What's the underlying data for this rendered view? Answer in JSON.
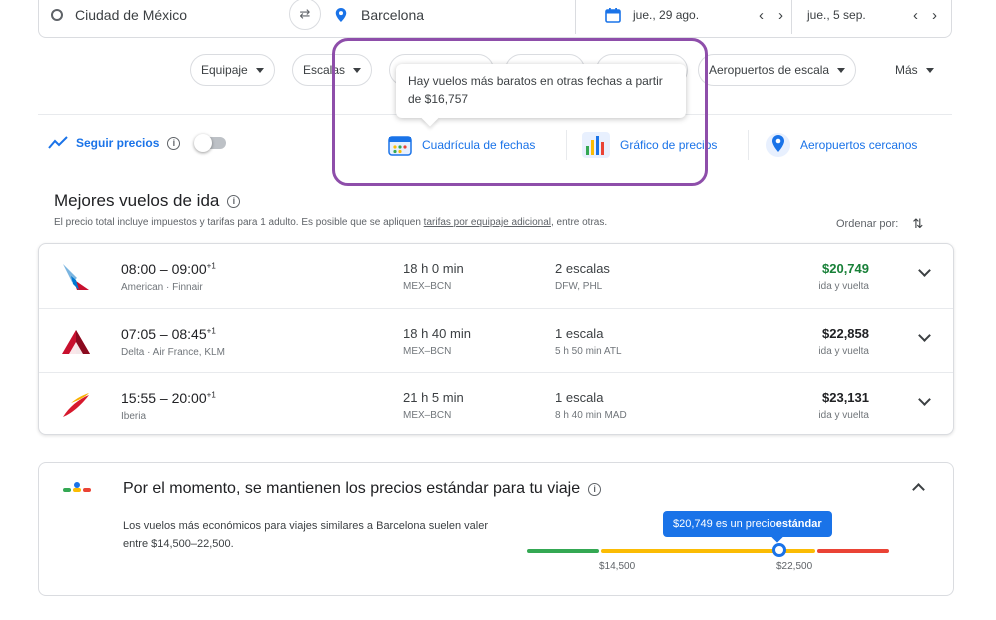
{
  "search": {
    "origin": "Ciudad de México",
    "destination": "Barcelona",
    "depart_date": "jue., 29 ago.",
    "return_date": "jue., 5 sep."
  },
  "filters": {
    "chips": [
      "Equipaje",
      "Escalas",
      "Aeropuertos de escala",
      "Más"
    ]
  },
  "tooltip": {
    "text": "Hay vuelos más baratos en otras fechas a partir de $16,757"
  },
  "tools": {
    "track_prices": "Seguir precios",
    "date_grid": "Cuadrícula de fechas",
    "price_graph": "Gráfico de precios",
    "nearby_airports": "Aeropuertos cercanos"
  },
  "results": {
    "title": "Mejores vuelos de ida",
    "disclaimer_pre": "El precio total incluye impuestos y tarifas para 1 adulto. Es posible que se apliquen ",
    "disclaimer_link": "tarifas por equipaje adicional",
    "disclaimer_post": ", entre otras.",
    "sort_label": "Ordenar por:",
    "flights": [
      {
        "times": "08:00 – 09:00",
        "day_offset": "+1",
        "airlines": "American · Finnair",
        "duration": "18 h 0 min",
        "route": "MEX–BCN",
        "stops": "2 escalas",
        "stop_detail": "DFW, PHL",
        "price": "$20,749",
        "price_note": "ida y vuelta",
        "price_color": "#188038"
      },
      {
        "times": "07:05 – 08:45",
        "day_offset": "+1",
        "airlines": "Delta · Air France, KLM",
        "duration": "18 h 40 min",
        "route": "MEX–BCN",
        "stops": "1 escala",
        "stop_detail": "5 h 50 min ATL",
        "price": "$22,858",
        "price_note": "ida y vuelta",
        "price_color": "#202124"
      },
      {
        "times": "15:55 – 20:00",
        "day_offset": "+1",
        "airlines": "Iberia",
        "duration": "21 h 5 min",
        "route": "MEX–BCN",
        "stops": "1 escala",
        "stop_detail": "8 h 40 min MAD",
        "price": "$23,131",
        "price_note": "ida y vuelta",
        "price_color": "#202124"
      }
    ]
  },
  "insight": {
    "title": "Por el momento, se mantienen los precios estándar para tu viaje",
    "body": "Los vuelos más económicos para viajes similares a Barcelona suelen valer entre $14,500–22,500.",
    "badge_pre": "$20,749 es un precio ",
    "badge_strong": "estándar",
    "scale_low": "$14,500",
    "scale_high": "$22,500",
    "current_price_value": 20749,
    "colors": {
      "low": "#34a853",
      "typical": "#fbbc04",
      "high": "#ea4335",
      "accent": "#1a73e8"
    }
  }
}
